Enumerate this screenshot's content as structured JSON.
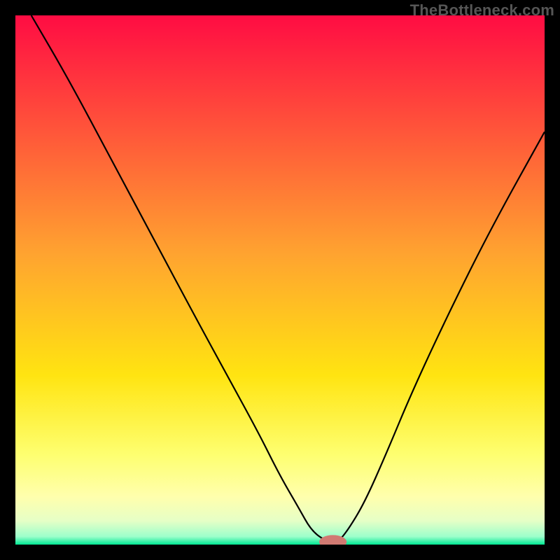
{
  "watermark": "TheBottleneck.com",
  "chart_data": {
    "type": "line",
    "title": "",
    "xlabel": "",
    "ylabel": "",
    "xlim": [
      0,
      100
    ],
    "ylim": [
      0,
      100
    ],
    "grid": false,
    "legend": false,
    "background_gradient_stops": [
      {
        "offset": 0.0,
        "color": "#ff0c43"
      },
      {
        "offset": 0.45,
        "color": "#ffa330"
      },
      {
        "offset": 0.68,
        "color": "#ffe411"
      },
      {
        "offset": 0.83,
        "color": "#feff70"
      },
      {
        "offset": 0.91,
        "color": "#ffffad"
      },
      {
        "offset": 0.955,
        "color": "#e6ffc6"
      },
      {
        "offset": 0.985,
        "color": "#9cffcb"
      },
      {
        "offset": 1.0,
        "color": "#00e893"
      }
    ],
    "series": [
      {
        "name": "bottleneck-curve",
        "color": "#000000",
        "width": 2.2,
        "x": [
          3,
          10,
          18,
          26,
          34,
          40,
          46,
          50,
          53.5,
          56,
          59,
          61,
          63,
          66,
          70,
          75,
          82,
          90,
          100
        ],
        "values": [
          100,
          88,
          73,
          58,
          43,
          32,
          21,
          13,
          7,
          2.5,
          0.5,
          0.5,
          3,
          8,
          17,
          29,
          44,
          60,
          78
        ]
      }
    ],
    "marker": {
      "name": "optimal-point",
      "x": 60,
      "y": 0.5,
      "color": "#d17a72",
      "rx": 2.6,
      "ry": 1.3
    }
  }
}
